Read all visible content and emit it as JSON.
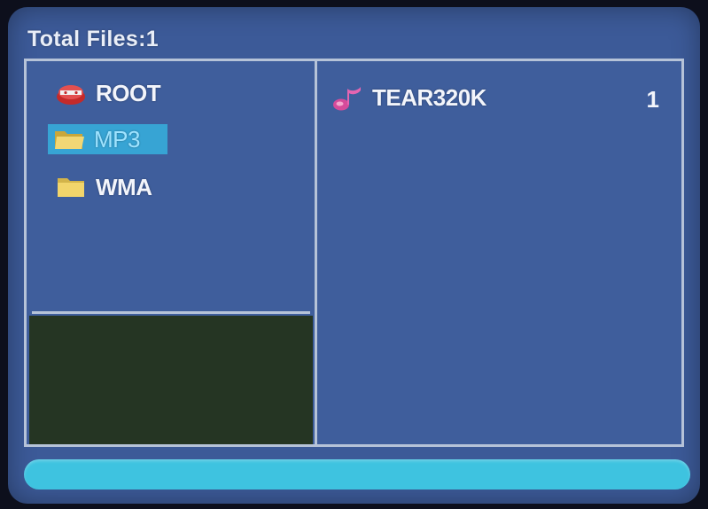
{
  "header": {
    "total_files_label": "Total Files:1"
  },
  "folders": [
    {
      "label": "ROOT",
      "icon": "root-drive-icon",
      "selected": false
    },
    {
      "label": "MP3",
      "icon": "folder-open-icon",
      "selected": true
    },
    {
      "label": "WMA",
      "icon": "folder-icon",
      "selected": false
    }
  ],
  "files": [
    {
      "name": "TEAR320K",
      "index": "1",
      "icon": "music-note-icon"
    }
  ],
  "colors": {
    "screen_bg": "#3c5a98",
    "border": "#b6c3d8",
    "selection": "#37a4d4",
    "preview_bg": "#253523",
    "progress_bar": "#3ec3e0"
  }
}
